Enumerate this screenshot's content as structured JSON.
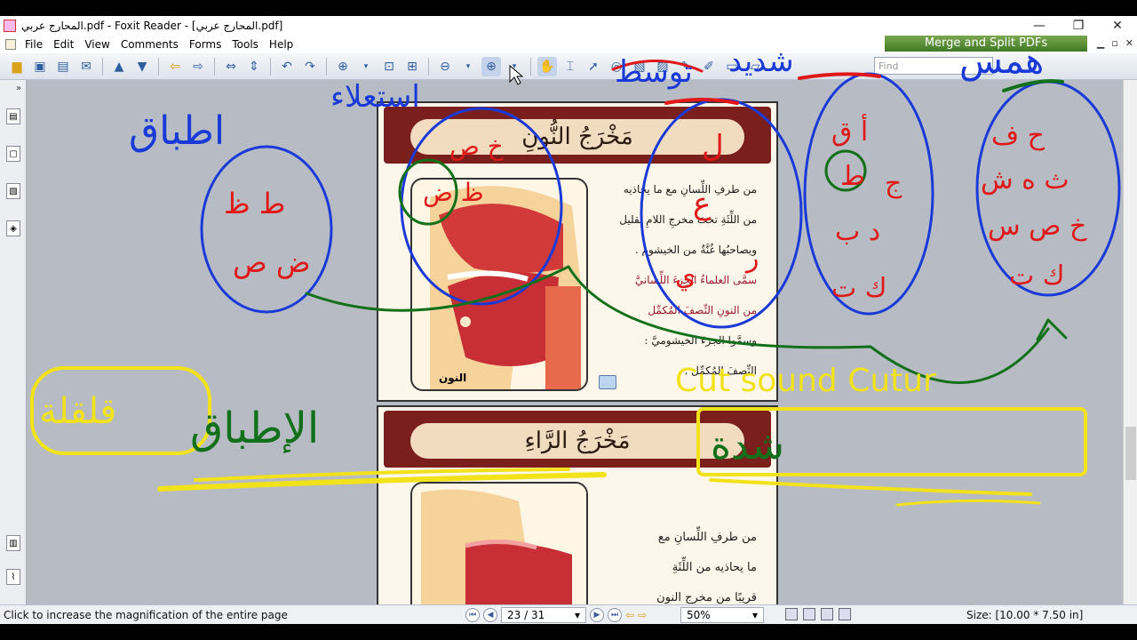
{
  "window": {
    "title": "المحارج عربي.pdf - Foxit Reader - [المحارج عربي.pdf]",
    "controls": {
      "minimize": "—",
      "maximize": "❐",
      "close": "✕"
    }
  },
  "menu": {
    "items": [
      "File",
      "Edit",
      "View",
      "Comments",
      "Forms",
      "Tools",
      "Help"
    ]
  },
  "banner": {
    "label": "Merge and Split PDFs"
  },
  "toolbar": {
    "find_placeholder": "Find"
  },
  "pages": [
    {
      "title": "مَخْرَجُ النُّونِ",
      "illustration_label": "النون",
      "lines": [
        "من طرفِ اللِّسانِ مع ما يحاذيه",
        "من اللِّثَةِ تحتَ مخرجِ اللامِ بقليل",
        "ويصاحبُها غُنَّةٌ من الخيشوم .",
        "سمَّى العلماءُ الجزءَ اللِّسانيَّ",
        "من النونِ النِّصفَ المُكمِّل",
        "وسمَّوا الجزءَ الخيشوميَّ :",
        "النِّصفَ المُكمِّل ."
      ]
    },
    {
      "title": "مَخْرَجُ الرَّاءِ",
      "lines": [
        "من طرفِ اللِّسانِ مع",
        "ما يحاذيه من اللِّثَةِ",
        "قريبًا من مخرجِ النون"
      ]
    }
  ],
  "status": {
    "message": "Click to increase the magnification of the entire page",
    "page_indicator": "23 / 31",
    "zoom": "50%",
    "size": "Size: [10.00 * 7.50 in]"
  },
  "annotations": {
    "left_top": "اطباق",
    "left_circle": [
      "ط ظ",
      "ض ص"
    ],
    "left_middle": "الإطباق",
    "istila": "استعلاء",
    "qalqala": "قلقلة",
    "shiddah": "شدة",
    "hams": "همس",
    "english": "Cut sound Cutur",
    "mouth_letters": "خ ص",
    "nose_letters": "ظ ض",
    "circle_mid": [
      "ل",
      "ع",
      "ر",
      "ي"
    ],
    "circle_r1": [
      "أ ق",
      "ط",
      "ج",
      "د ب",
      "ك ت"
    ],
    "circle_r2": [
      "ح ف",
      "ث ه ش",
      "خ ص س",
      "ك ت"
    ],
    "tawassut": "توسط",
    "shadid": "شديد"
  },
  "colors": {
    "ink_blue": "#1a3ad8",
    "ink_red": "#e01818",
    "ink_green": "#13701a",
    "ink_yellow": "#f2e21a",
    "header_red": "#7a1f1c"
  }
}
